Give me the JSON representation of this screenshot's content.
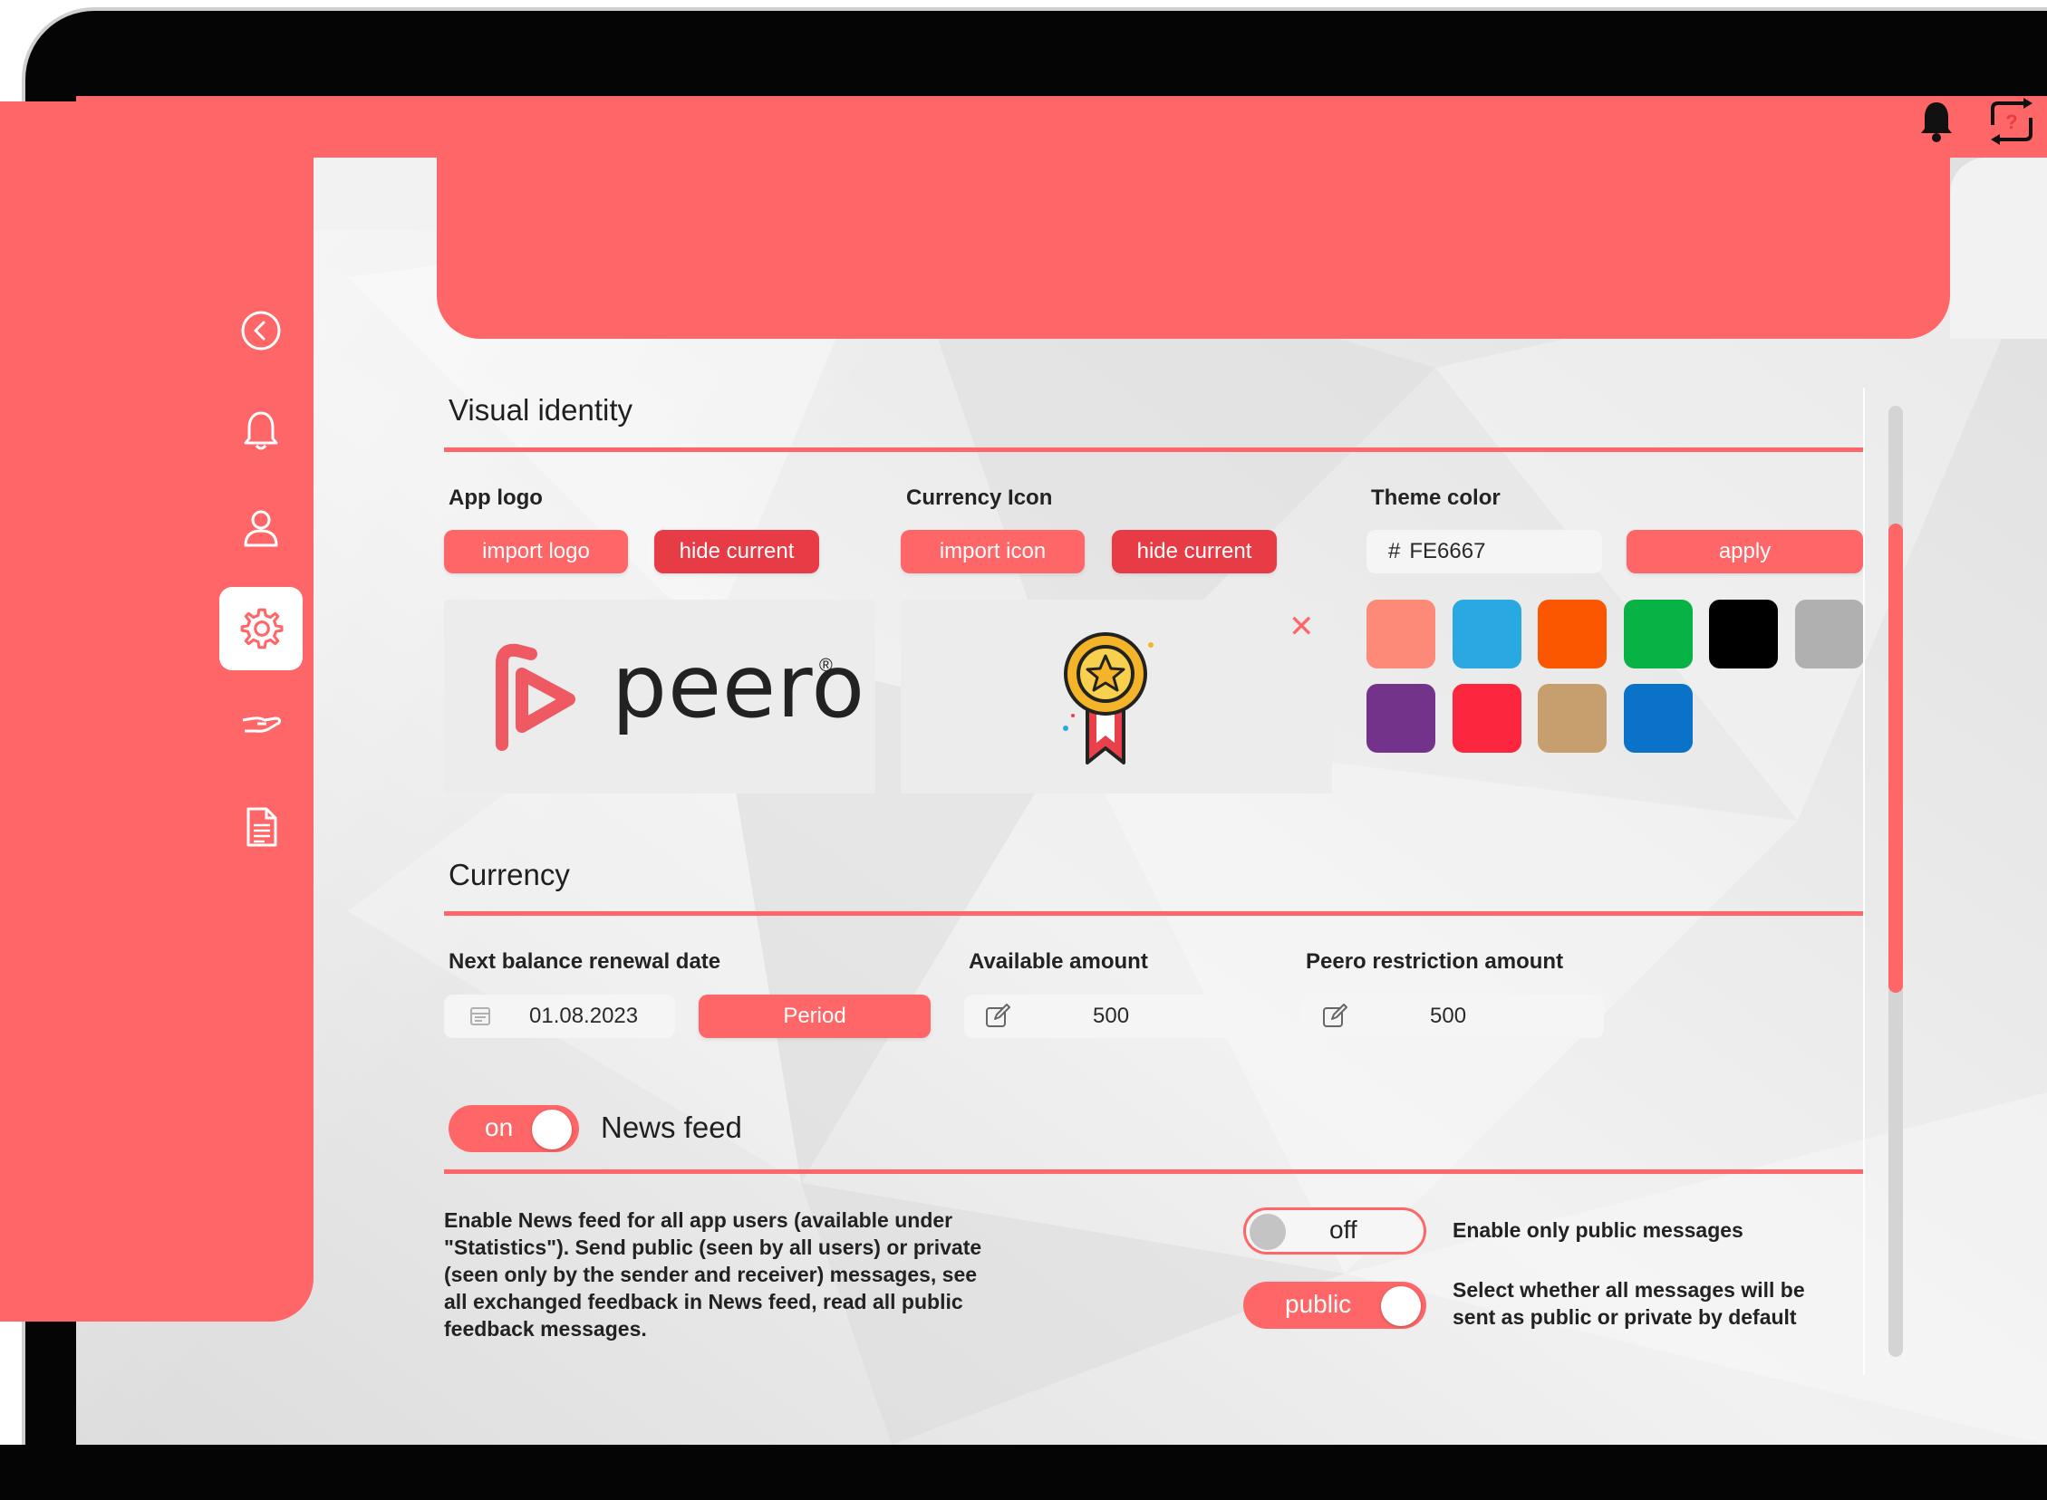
{
  "header": {
    "bell_icon": "bell-icon",
    "help_icon": "help-swap-icon"
  },
  "sidebar": {
    "items": [
      {
        "name": "back",
        "icon": "chevron-left-circle-icon"
      },
      {
        "name": "notifications",
        "icon": "bell-outline-icon"
      },
      {
        "name": "users",
        "icon": "user-icon"
      },
      {
        "name": "settings",
        "icon": "gear-icon",
        "active": true
      },
      {
        "name": "rewards",
        "icon": "hand-icon"
      },
      {
        "name": "documents",
        "icon": "document-icon"
      }
    ]
  },
  "visual_identity": {
    "title": "Visual identity",
    "app_logo": {
      "label": "App logo",
      "import_label": "import logo",
      "hide_label": "hide current",
      "logo_text": "peero",
      "logo_mark": "®"
    },
    "currency_icon": {
      "label": "Currency Icon",
      "import_label": "import icon",
      "hide_label": "hide current",
      "remove_symbol": "✕",
      "icon": "medal-icon"
    },
    "theme_color": {
      "label": "Theme color",
      "prefix": "#",
      "value": "FE6667",
      "apply_label": "apply",
      "swatches": [
        "#FD8A78",
        "#29A8E2",
        "#FB5600",
        "#08B345",
        "#000000",
        "#B0B0B0",
        "#74338A",
        "#FC263E",
        "#C79F6E",
        "#0A72C8"
      ]
    }
  },
  "currency": {
    "title": "Currency",
    "renewal": {
      "label": "Next balance renewal date",
      "value": "01.08.2023",
      "period_label": "Period"
    },
    "available": {
      "label": "Available amount",
      "value": "500"
    },
    "restriction": {
      "label": "Peero restriction amount",
      "value": "500"
    }
  },
  "news_feed": {
    "toggle_label": "on",
    "title": "News feed",
    "description_lines": [
      "Enable News feed for all app users (available under",
      "\"Statistics\"). Send public (seen by all users) or private",
      "(seen only by the sender and receiver) messages, see",
      "all exchanged feedback in News feed, read all public",
      "feedback messages."
    ],
    "public_only": {
      "toggle_label": "off",
      "label": "Enable only public messages"
    },
    "default_visibility": {
      "toggle_label": "public",
      "label_lines": [
        "Select whether all messages will be",
        "sent as public or private by default"
      ]
    }
  },
  "colors": {
    "accent": "#FE6667",
    "accent_dark": "#E73B46"
  }
}
